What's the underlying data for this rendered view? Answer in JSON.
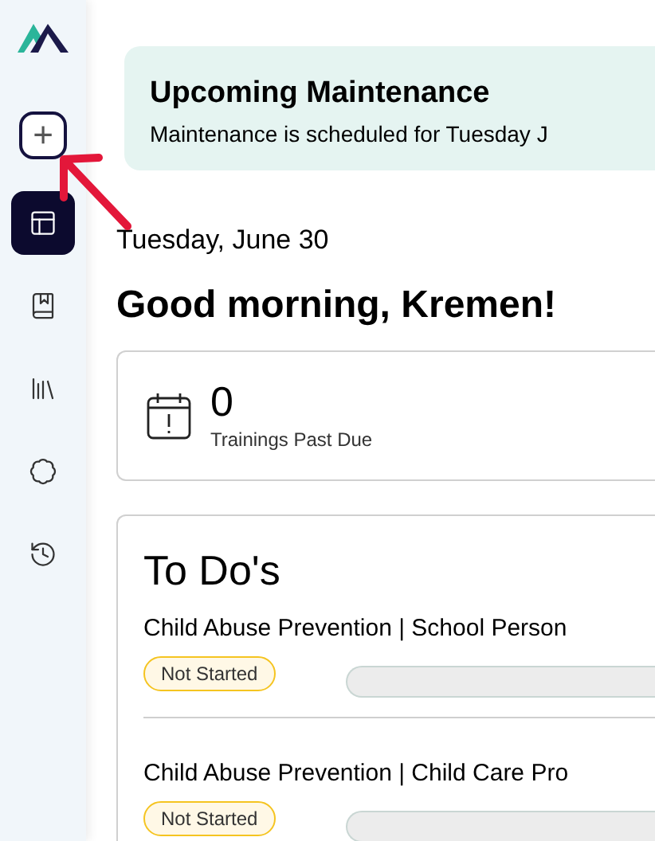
{
  "sidebar": {
    "add_button": {
      "label": "+"
    },
    "items": [
      {
        "selected": true
      },
      {
        "selected": false
      },
      {
        "selected": false
      },
      {
        "selected": false
      },
      {
        "selected": false
      }
    ]
  },
  "banner": {
    "title": "Upcoming Maintenance",
    "text": "Maintenance is scheduled for Tuesday J"
  },
  "date": "Tuesday, June 30",
  "greeting": "Good morning, Kremen!",
  "stat": {
    "value": "0",
    "label": "Trainings Past Due"
  },
  "todos": {
    "title": "To Do's",
    "items": [
      {
        "title": "Child Abuse Prevention | School Person",
        "status": "Not Started",
        "level": 0
      },
      {
        "title": "Child Abuse Prevention | Child Care Pro",
        "status": "Not Started",
        "level": 0
      }
    ]
  }
}
